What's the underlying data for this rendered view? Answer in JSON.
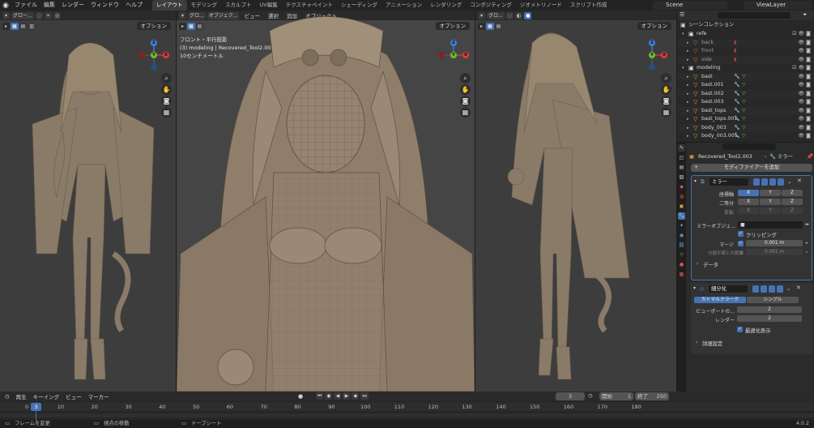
{
  "topbar": {
    "menus": [
      "ファイル",
      "編集",
      "レンダー",
      "ウィンドウ",
      "ヘルプ"
    ],
    "workspaces": [
      "レイアウト",
      "モデリング",
      "スカルプト",
      "UV編集",
      "テクスチャペイント",
      "シェーディング",
      "アニメーション",
      "レンダリング",
      "コンポジティング",
      "ジオメトリノード",
      "スクリプト作成"
    ],
    "active_workspace": "レイアウト",
    "scene": "Scene",
    "view_layer": "ViewLayer"
  },
  "viewport_left": {
    "mode_label": "グロー...",
    "options": "オプション"
  },
  "viewport_center": {
    "mode_label": "グロ...",
    "object_mode": "オブジェク...",
    "menus": [
      "ビュー",
      "選択",
      "追加",
      "オブジェクト"
    ],
    "options": "オプション",
    "info_line1": "フロント・平行投影",
    "info_line2": "(3) modeling | Recovered_Tool2.003",
    "info_line3": "10センチメートル"
  },
  "viewport_right": {
    "mode_label": "グロ...",
    "options": "オプション"
  },
  "gizmo": {
    "x": "X",
    "y": "Y",
    "z": "Z"
  },
  "outliner": {
    "title": "シーンコレクション",
    "collections": [
      {
        "name": "refe",
        "indent": 1
      },
      {
        "name": "back",
        "indent": 2
      },
      {
        "name": "front",
        "indent": 2
      },
      {
        "name": "side",
        "indent": 2
      },
      {
        "name": "modeling",
        "indent": 1
      },
      {
        "name": "bast",
        "indent": 2
      },
      {
        "name": "bast.001",
        "indent": 2
      },
      {
        "name": "bast.002",
        "indent": 2
      },
      {
        "name": "bast.003",
        "indent": 2
      },
      {
        "name": "bast_tops",
        "indent": 2
      },
      {
        "name": "bast_tops.001",
        "indent": 2
      },
      {
        "name": "body_003",
        "indent": 2
      },
      {
        "name": "body_003.001",
        "indent": 2
      }
    ]
  },
  "properties": {
    "object_name": "Recovered_Tool2.003",
    "modifier_tab": "ミラー",
    "add_modifier": "モディファイアーを追加",
    "mirror": {
      "name": "ミラー",
      "axis_label": "座標軸",
      "bisect_label": "二等分",
      "flip_label": "反転",
      "axes": [
        "X",
        "Y",
        "Z"
      ],
      "mirror_object_label": "ミラーオブジェ...",
      "clipping": "クリッピング",
      "merge_label": "マージ",
      "merge_value": "0.001 m",
      "bisect_distance_label": "分割平面との距離",
      "bisect_distance_value": "0.001 m",
      "data": "データ"
    },
    "subsurf": {
      "name": "細分化",
      "catmull": "カトマルクラーク",
      "simple": "シンプル",
      "viewport_label": "ビューポートの...",
      "viewport_value": "2",
      "render_label": "レンダー",
      "render_value": "2",
      "optimal": "最適化表示",
      "advanced": "詳細設定"
    }
  },
  "timeline": {
    "menus": [
      "再生",
      "キーイング",
      "ビュー",
      "マーカー"
    ],
    "current_frame": "3",
    "start_label": "開始",
    "start_value": "1",
    "end_label": "終了",
    "end_value": "250",
    "ticks": [
      "0",
      "10",
      "20",
      "30",
      "40",
      "50",
      "60",
      "70",
      "80",
      "90",
      "100",
      "110",
      "120",
      "130",
      "140",
      "150",
      "160",
      "170",
      "180"
    ],
    "playhead": "3"
  },
  "status": {
    "select": "フレームを変更",
    "move": "視点の移動",
    "dope": "ドープシート",
    "version": "4.0.2"
  },
  "colors": {
    "accent": "#4772b3",
    "x_axis": "#e03a3a",
    "y_axis": "#6fbd2a",
    "z_axis": "#3f82e0",
    "bg": "#3d3d3d"
  }
}
